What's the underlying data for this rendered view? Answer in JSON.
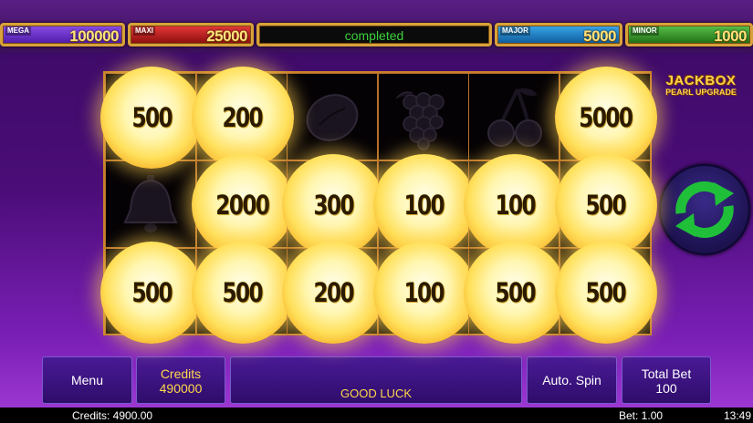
{
  "jackpots": {
    "mega": {
      "label": "MEGA",
      "value": "100000"
    },
    "maxi": {
      "label": "MAXI",
      "value": "25000"
    },
    "status": "completed",
    "major": {
      "label": "MAJOR",
      "value": "5000"
    },
    "minor": {
      "label": "MINOR",
      "value": "1000"
    }
  },
  "logo": {
    "line1": "JACKBOX",
    "line2": "PEARL UPGRADE"
  },
  "grid": [
    [
      {
        "type": "pearl",
        "value": "500"
      },
      {
        "type": "pearl",
        "value": "200"
      },
      {
        "type": "symbol",
        "icon": "plum-icon"
      },
      {
        "type": "symbol",
        "icon": "grapes-icon"
      },
      {
        "type": "symbol",
        "icon": "cherries-icon"
      },
      {
        "type": "pearl",
        "value": "5000"
      }
    ],
    [
      {
        "type": "symbol",
        "icon": "bell-icon"
      },
      {
        "type": "pearl",
        "value": "2000"
      },
      {
        "type": "pearl",
        "value": "300"
      },
      {
        "type": "pearl",
        "value": "100"
      },
      {
        "type": "pearl",
        "value": "100"
      },
      {
        "type": "pearl",
        "value": "500"
      }
    ],
    [
      {
        "type": "pearl",
        "value": "500"
      },
      {
        "type": "pearl",
        "value": "500"
      },
      {
        "type": "pearl",
        "value": "200"
      },
      {
        "type": "pearl",
        "value": "100"
      },
      {
        "type": "pearl",
        "value": "500"
      },
      {
        "type": "pearl",
        "value": "500"
      }
    ]
  ],
  "panel": {
    "menu": "Menu",
    "credits_label": "Credits",
    "credits_value": "490000",
    "message": "GOOD LUCK",
    "auto_spin": "Auto. Spin",
    "total_bet_label": "Total Bet",
    "total_bet_value": "100"
  },
  "statusbar": {
    "credits": "Credits: 4900.00",
    "bet": "Bet: 1.00",
    "time": "13:49"
  },
  "colors": {
    "accent_gold": "#ffd84a",
    "status_green": "#3bd13b",
    "spin_arrow": "#1fbf3a"
  }
}
